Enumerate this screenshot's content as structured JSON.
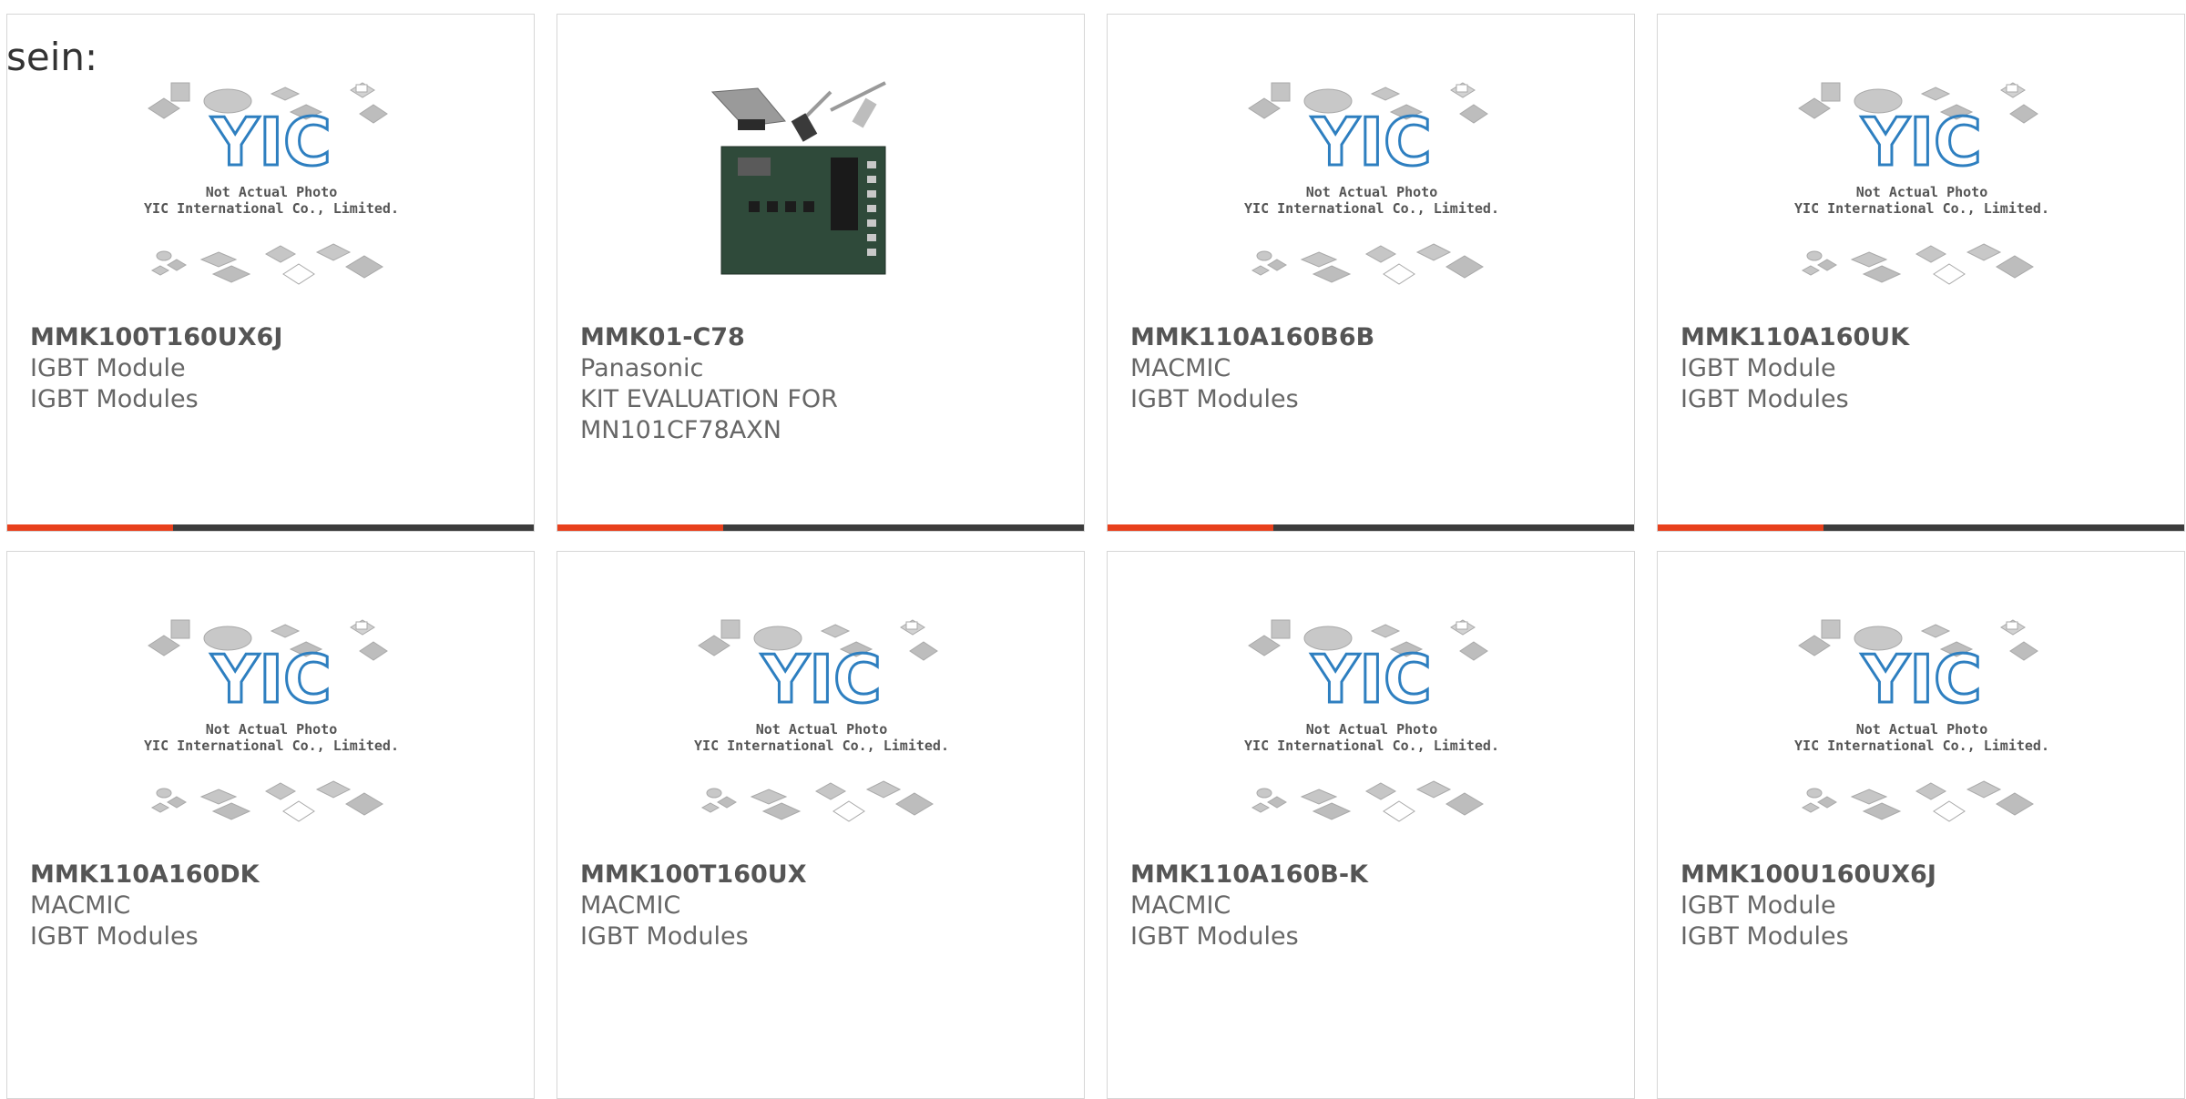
{
  "fragment_text": "sein:",
  "colors": {
    "accent": "#e8401c",
    "bar": "#3c3c3c",
    "border": "#d6d6d6",
    "logo": "#2e7fc0"
  },
  "placeholder": {
    "line1": "Not Actual Photo",
    "line2": "YIC International Co., Limited.",
    "logo_text": "YIC"
  },
  "products": [
    {
      "pn": "MMK100T160UX6J",
      "lines": [
        "IGBT Module",
        "IGBT Modules"
      ],
      "image": "placeholder",
      "accent_bar": true
    },
    {
      "pn": "MMK01-C78",
      "lines": [
        "Panasonic",
        "KIT EVALUATION FOR MN101CF78AXN"
      ],
      "image": "eval-board-photo",
      "accent_bar": true
    },
    {
      "pn": "MMK110A160B6B",
      "lines": [
        "MACMIC",
        "IGBT Modules"
      ],
      "image": "placeholder",
      "accent_bar": true
    },
    {
      "pn": "MMK110A160UK",
      "lines": [
        "IGBT Module",
        "IGBT Modules"
      ],
      "image": "placeholder",
      "accent_bar": true
    },
    {
      "pn": "MMK110A160DK",
      "lines": [
        "MACMIC",
        "IGBT Modules"
      ],
      "image": "placeholder",
      "accent_bar": false
    },
    {
      "pn": "MMK100T160UX",
      "lines": [
        "MACMIC",
        "IGBT Modules"
      ],
      "image": "placeholder",
      "accent_bar": false
    },
    {
      "pn": "MMK110A160B-K",
      "lines": [
        "MACMIC",
        "IGBT Modules"
      ],
      "image": "placeholder",
      "accent_bar": false
    },
    {
      "pn": "MMK100U160UX6J",
      "lines": [
        "IGBT Module",
        "IGBT Modules"
      ],
      "image": "placeholder",
      "accent_bar": false
    }
  ]
}
